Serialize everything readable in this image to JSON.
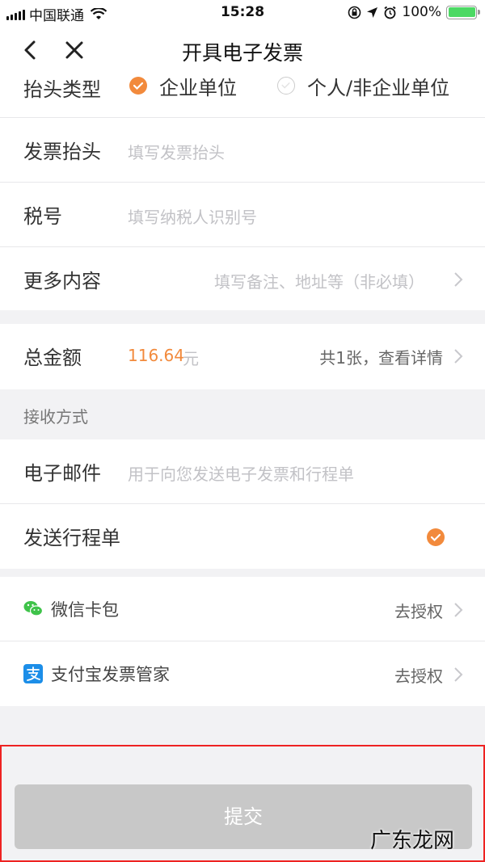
{
  "status_bar": {
    "carrier": "中国联通",
    "time": "15:28",
    "battery": "100%"
  },
  "nav": {
    "title": "开具电子发票"
  },
  "form": {
    "title_type": {
      "label": "抬头类型",
      "option_company": "企业单位",
      "option_personal": "个人/非企业单位",
      "selected": "企业单位"
    },
    "invoice_title": {
      "label": "发票抬头",
      "placeholder": "填写发票抬头"
    },
    "tax_number": {
      "label": "税号",
      "placeholder": "填写纳税人识别号"
    },
    "more": {
      "label": "更多内容",
      "placeholder": "填写备注、地址等（非必填）"
    }
  },
  "total": {
    "label": "总金额",
    "amount": "116.64",
    "unit": "元",
    "detail": "共1张，查看详情"
  },
  "receive": {
    "header": "接收方式",
    "email": {
      "label": "电子邮件",
      "placeholder": "用于向您发送电子发票和行程单"
    },
    "itinerary": {
      "label": "发送行程单"
    }
  },
  "auth": {
    "wechat": {
      "label": "微信卡包",
      "action": "去授权"
    },
    "alipay": {
      "label": "支付宝发票管家",
      "action": "去授权"
    }
  },
  "submit_label": "提交",
  "watermark": "广东龙网",
  "colors": {
    "accent": "#f28a3c",
    "submit_disabled": "#c8c8c8",
    "highlight_border": "#e22222",
    "wechat_green": "#3fc34a",
    "alipay_blue": "#1c8ee8"
  }
}
